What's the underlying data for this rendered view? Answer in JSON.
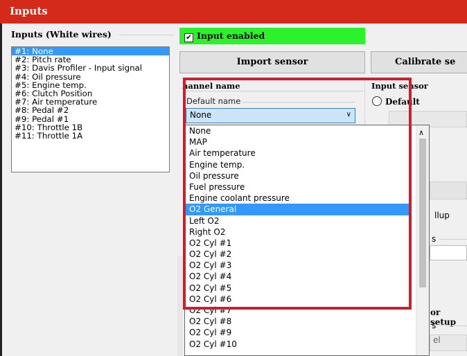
{
  "window": {
    "title": "Inputs"
  },
  "inputs_group": {
    "label": "Inputs (White wires)",
    "items": [
      "#1: None",
      "#2: Pitch rate",
      "#3: Davis Profiler - Input signal",
      "#4: Oil pressure",
      "#5: Engine temp.",
      "#6: Clutch Position",
      "#7: Air temperature",
      "#8: Pedal #2",
      "#9: Pedal #1",
      "#10: Throttle 1B",
      "#11: Throttle 1A"
    ],
    "selected_index": 0
  },
  "input_enabled": {
    "label": "Input enabled",
    "checked": true,
    "check_glyph": "✔"
  },
  "buttons": {
    "import_sensor": "Import sensor",
    "calibrate": "Calibrate se"
  },
  "channel_name": {
    "heading": "hannel name",
    "default_name_label": "Default name",
    "selected_value": "None"
  },
  "input_sensor": {
    "heading": "Input sensor",
    "default_radio_label": "Default"
  },
  "dropdown_options": [
    "None",
    "MAP",
    "Air temperature",
    "Engine temp.",
    "Oil pressure",
    "Fuel pressure",
    "Engine coolant pressure",
    "O2 General",
    "Left O2",
    "Right O2",
    "O2 Cyl #1",
    "O2 Cyl #2",
    "O2 Cyl #3",
    "O2 Cyl #4",
    "O2 Cyl #5",
    "O2 Cyl #6",
    "O2 Cyl #7",
    "O2 Cyl #8",
    "O2 Cyl #9",
    "O2 Cyl #10"
  ],
  "dropdown_selected_index": 7,
  "right_panel_fragments": {
    "pullup": "llup",
    "s_label": "s",
    "setup": "or setup",
    "s_label2": "s",
    "el": "el"
  },
  "colors": {
    "title_bg": "#d42a1c",
    "enabled_bg": "#2bf22b",
    "selection": "#3399ff",
    "highlight_box": "#c8202e"
  },
  "icons": {
    "dropdown_arrow": "chevron-down-icon",
    "scroll_up": "scroll-up-arrow-icon"
  }
}
